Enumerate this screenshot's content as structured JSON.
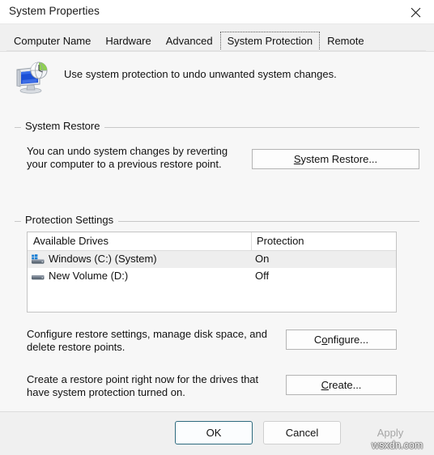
{
  "window": {
    "title": "System Properties",
    "close_icon": "close-icon"
  },
  "tabs": [
    {
      "label": "Computer Name",
      "selected": false
    },
    {
      "label": "Hardware",
      "selected": false
    },
    {
      "label": "Advanced",
      "selected": false
    },
    {
      "label": "System Protection",
      "selected": true
    },
    {
      "label": "Remote",
      "selected": false
    }
  ],
  "header": {
    "icon": "system-protection-computer-icon",
    "description": "Use system protection to undo unwanted system changes."
  },
  "system_restore": {
    "group_label": "System Restore",
    "description_line1": "You can undo system changes by reverting",
    "description_line2": "your computer to a previous restore point.",
    "button_label": "System Restore...",
    "button_accel": "S",
    "button_rest": "ystem Restore..."
  },
  "protection_settings": {
    "group_label": "Protection Settings",
    "table": {
      "columns": [
        "Available Drives",
        "Protection"
      ],
      "rows": [
        {
          "icon": "windows-system-drive-icon",
          "drive": "Windows (C:) (System)",
          "protection": "On",
          "selected": true
        },
        {
          "icon": "hard-drive-icon",
          "drive": "New Volume (D:)",
          "protection": "Off",
          "selected": false
        }
      ]
    },
    "configure": {
      "description_line1": "Configure restore settings, manage disk space, and",
      "description_line2": "delete restore points.",
      "button_prefix": "C",
      "button_accel": "o",
      "button_suffix": "nfigure..."
    },
    "create": {
      "description_line1": "Create a restore point right now for the drives that",
      "description_line2": "have system protection turned on.",
      "button_accel": "C",
      "button_suffix": "reate..."
    }
  },
  "footer": {
    "ok_label": "OK",
    "cancel_label": "Cancel",
    "apply_label": "Apply",
    "apply_disabled": true
  },
  "watermark": {
    "text": "wsxdn.com"
  },
  "colors": {
    "dialog_bg": "#f0f0f0",
    "pane_bg": "#f7f7f7",
    "titlebar_bg": "#ffffff",
    "text": "#111111",
    "group_line": "#c8c8c8",
    "listview_border": "#c4c4c4",
    "row_selected": "#eeeeee",
    "default_button_border": "#2d6a7e",
    "disabled_text": "#a6a6a6"
  }
}
